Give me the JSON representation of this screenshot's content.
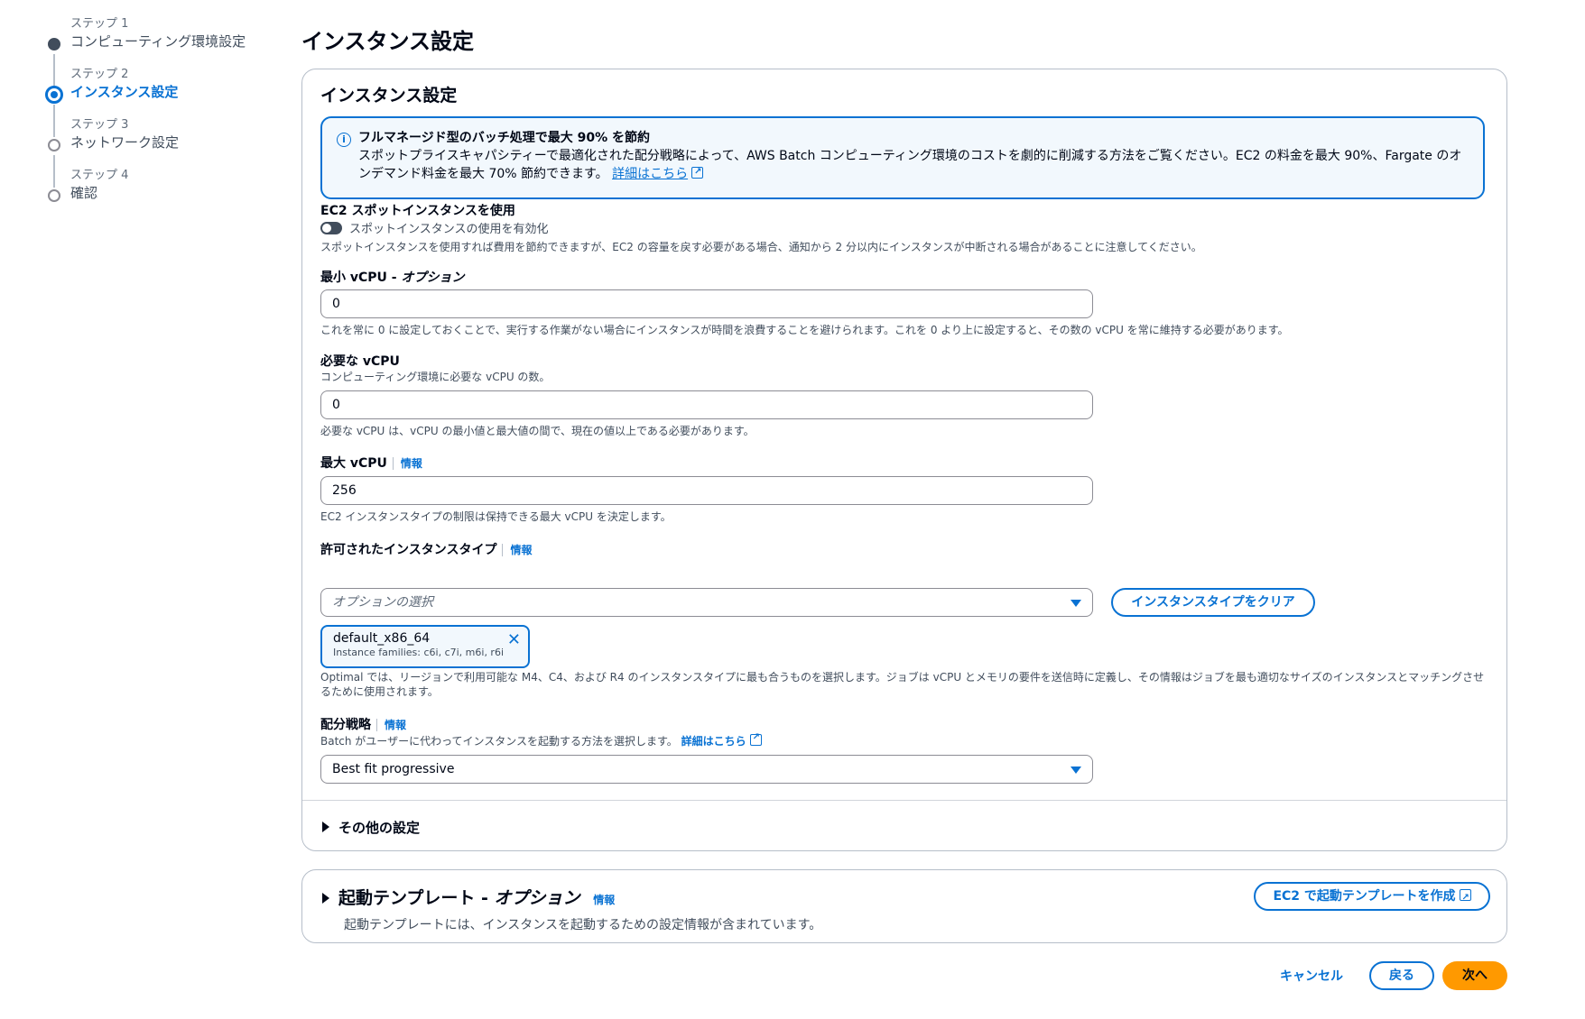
{
  "steps": [
    {
      "num": "ステップ 1",
      "label": "コンピューティング環境設定",
      "state": "done"
    },
    {
      "num": "ステップ 2",
      "label": "インスタンス設定",
      "state": "active"
    },
    {
      "num": "ステップ 3",
      "label": "ネットワーク設定",
      "state": "pending"
    },
    {
      "num": "ステップ 4",
      "label": "確認",
      "state": "pending"
    }
  ],
  "page_title": "インスタンス設定",
  "card": {
    "title": "インスタンス設定",
    "info": {
      "icon": "info-icon",
      "heading": "フルマネージド型のバッチ処理で最大 90% を節約",
      "body": "スポットプライスキャパシティーで最適化された配分戦略によって、AWS Batch コンピューティング環境のコストを劇的に削減する方法をご覧ください。EC2 の料金を最大 90%、Fargate のオンデマンド料金を最大 70% 節約できます。",
      "link": "詳細はこちら"
    },
    "spot": {
      "label": "EC2 スポットインスタンスを使用",
      "toggle_label": "スポットインスタンスの使用を有効化",
      "toggle_on": false,
      "desc": "スポットインスタンスを使用すれば費用を節約できますが、EC2 の容量を戻す必要がある場合、通知から 2 分以内にインスタンスが中断される場合があることに注意してください。"
    },
    "min_vcpu": {
      "label": "最小 vCPU - ",
      "label_opt": "オプション",
      "value": "0",
      "desc": "これを常に 0 に設定しておくことで、実行する作業がない場合にインスタンスが時間を浪費することを避けられます。これを 0 より上に設定すると、その数の vCPU を常に維持する必要があります。"
    },
    "desired_vcpu": {
      "label": "必要な vCPU",
      "sub": "コンピューティング環境に必要な vCPU の数。",
      "value": "0",
      "desc": "必要な vCPU は、vCPU の最小値と最大値の間で、現在の値以上である必要があります。"
    },
    "max_vcpu": {
      "label": "最大 vCPU",
      "info": "情報",
      "value": "256",
      "desc": "EC2 インスタンスタイプの制限は保持できる最大 vCPU を決定します。"
    },
    "instance_types": {
      "label": "許可されたインスタンスタイプ",
      "info": "情報",
      "placeholder": "オプションの選択",
      "clear_button": "インスタンスタイプをクリア",
      "token_name": "default_x86_64",
      "token_sub": "Instance families: c6i, c7i, m6i, r6i",
      "desc": "Optimal では、リージョンで利用可能な M4、C4、および R4 のインスタンスタイプに最も合うものを選択します。ジョブは vCPU とメモリの要件を送信時に定義し、その情報はジョブを最も適切なサイズのインスタンスとマッチングさせるために使用されます。"
    },
    "allocation": {
      "label": "配分戦略",
      "info": "情報",
      "sub": "Batch がユーザーに代わってインスタンスを起動する方法を選択します。",
      "link": "詳細はこちら",
      "value": "Best fit progressive"
    },
    "other_settings": "その他の設定"
  },
  "launch_template": {
    "title": "起動テンプレート - ",
    "title_opt": "オプション",
    "info": "情報",
    "desc": "起動テンプレートには、インスタンスを起動するための設定情報が含まれています。",
    "create_button": "EC2 で起動テンプレートを作成"
  },
  "footer": {
    "cancel": "キャンセル",
    "back": "戻る",
    "next": "次へ"
  },
  "colors": {
    "accent": "#0972d3",
    "primary_button": "#ff9900"
  }
}
